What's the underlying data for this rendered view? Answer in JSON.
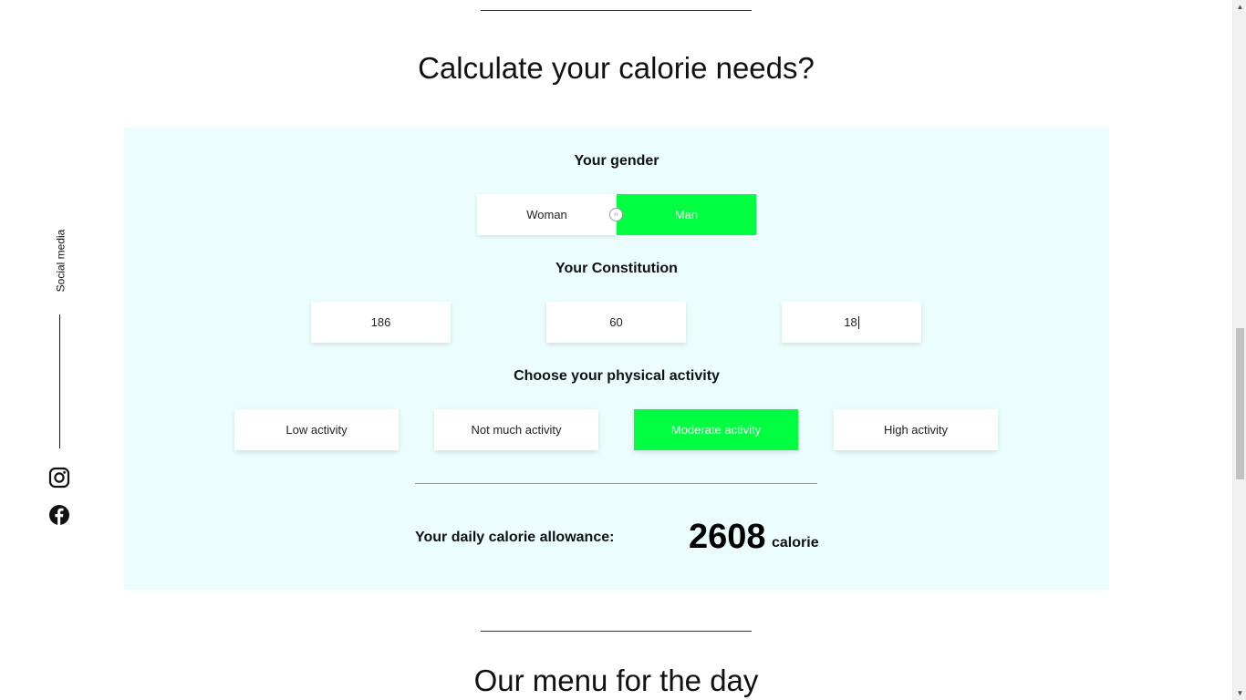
{
  "calculator": {
    "title": "Calculate your calorie needs?",
    "gender": {
      "heading": "Your gender",
      "options": [
        "Woman",
        "Man"
      ],
      "selected": "Man"
    },
    "constitution": {
      "heading": "Your Constitution",
      "height_value": "186",
      "weight_value": "60",
      "age_value": "18"
    },
    "activity": {
      "heading": "Choose your physical activity",
      "options": [
        "Low activity",
        "Not much activity",
        "Moderate activity",
        "High activity"
      ],
      "selected": "Moderate activity"
    },
    "result": {
      "label": "Your daily calorie allowance:",
      "value": "2608",
      "unit": "calorie"
    }
  },
  "menu_section": {
    "title": "Our menu for the day"
  },
  "social": {
    "label": "Social media",
    "icons": [
      "instagram-icon",
      "facebook-icon"
    ]
  },
  "colors": {
    "accent": "#00ff40",
    "panel_background": "#ebfefd"
  }
}
